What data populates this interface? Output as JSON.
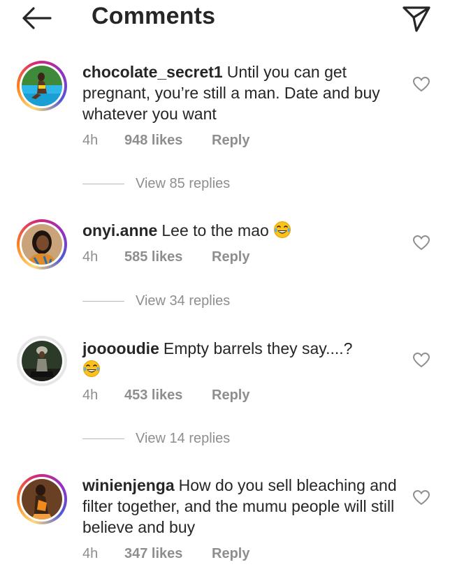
{
  "header": {
    "title": "Comments",
    "back_icon": "arrow-left-icon",
    "share_icon": "paper-plane-icon"
  },
  "comments": [
    {
      "username": "chocolate_secret1",
      "text": "Until you can get pregnant, you’re still a man. Date and buy whatever you want",
      "emoji": "",
      "time": "4h",
      "likes": "948 likes",
      "reply": "Reply",
      "view_replies": "View 85 replies",
      "avatar_story_ring": true
    },
    {
      "username": "onyi.anne",
      "text": "Lee to the mao",
      "emoji": "face-with-tears-of-joy",
      "time": "4h",
      "likes": "585 likes",
      "reply": "Reply",
      "view_replies": "View 34 replies",
      "avatar_story_ring": true
    },
    {
      "username": "jooooudie",
      "text": "Empty barrels they say....?",
      "emoji": "face-with-tears-of-joy",
      "time": "4h",
      "likes": "453 likes",
      "reply": "Reply",
      "view_replies": "View 14 replies",
      "avatar_story_ring": false
    },
    {
      "username": "winienjenga",
      "text": "How do you sell bleaching and filter together, and the mumu people will still believe and buy",
      "emoji": "",
      "time": "4h",
      "likes": "347 likes",
      "reply": "Reply",
      "avatar_story_ring": true
    }
  ],
  "colors": {
    "text": "#262626",
    "secondary": "#8e8e8e"
  }
}
